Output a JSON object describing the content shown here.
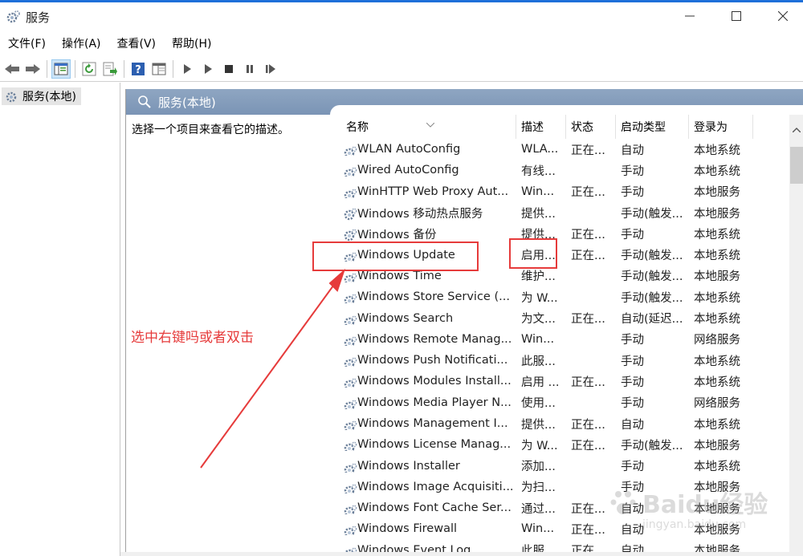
{
  "window": {
    "title": "服务",
    "accent": "#1e6fd9"
  },
  "menu": [
    "文件(F)",
    "操作(A)",
    "查看(V)",
    "帮助(H)"
  ],
  "toolbar_icons": [
    "back-icon",
    "forward-icon",
    "show-hide-tree-icon",
    "refresh-icon",
    "export-list-icon",
    "help-icon",
    "properties-icon",
    "start-service-icon",
    "start-icon",
    "stop-service-icon",
    "pause-service-icon",
    "restart-service-icon"
  ],
  "tree": {
    "root": "服务(本地)"
  },
  "pane": {
    "header": "服务(本地)",
    "description": "选择一个项目来查看它的描述。"
  },
  "columns": {
    "name": "名称",
    "desc": "描述",
    "status": "状态",
    "type": "启动类型",
    "logon": "登录为"
  },
  "services": [
    {
      "name": "WLAN AutoConfig",
      "desc": "WLA...",
      "status": "正在...",
      "type": "自动",
      "logon": "本地系统"
    },
    {
      "name": "Wired AutoConfig",
      "desc": "有线...",
      "status": "",
      "type": "手动",
      "logon": "本地系统"
    },
    {
      "name": "WinHTTP Web Proxy Aut...",
      "desc": "Win...",
      "status": "正在...",
      "type": "手动",
      "logon": "本地服务"
    },
    {
      "name": "Windows 移动热点服务",
      "desc": "提供...",
      "status": "",
      "type": "手动(触发...",
      "logon": "本地服务"
    },
    {
      "name": "Windows 备份",
      "desc": "提供...",
      "status": "正在...",
      "type": "手动",
      "logon": "本地系统"
    },
    {
      "name": "Windows Update",
      "desc": "启用...",
      "status": "正在...",
      "type": "手动(触发...",
      "logon": "本地系统"
    },
    {
      "name": "Windows Time",
      "desc": "维护...",
      "status": "",
      "type": "手动(触发...",
      "logon": "本地服务"
    },
    {
      "name": "Windows Store Service (...",
      "desc": "为 W...",
      "status": "",
      "type": "手动(触发...",
      "logon": "本地系统"
    },
    {
      "name": "Windows Search",
      "desc": "为文...",
      "status": "正在...",
      "type": "自动(延迟...",
      "logon": "本地系统"
    },
    {
      "name": "Windows Remote Manag...",
      "desc": "Win...",
      "status": "",
      "type": "手动",
      "logon": "网络服务"
    },
    {
      "name": "Windows Push Notificati...",
      "desc": "此服...",
      "status": "",
      "type": "手动",
      "logon": "本地系统"
    },
    {
      "name": "Windows Modules Install...",
      "desc": "启用 ...",
      "status": "正在...",
      "type": "手动",
      "logon": "本地系统"
    },
    {
      "name": "Windows Media Player N...",
      "desc": "使用...",
      "status": "",
      "type": "手动",
      "logon": "网络服务"
    },
    {
      "name": "Windows Management I...",
      "desc": "提供...",
      "status": "正在...",
      "type": "自动",
      "logon": "本地系统"
    },
    {
      "name": "Windows License Manag...",
      "desc": "为 W...",
      "status": "正在...",
      "type": "手动(触发...",
      "logon": "本地服务"
    },
    {
      "name": "Windows Installer",
      "desc": "添加...",
      "status": "",
      "type": "手动",
      "logon": "本地系统"
    },
    {
      "name": "Windows Image Acquisiti...",
      "desc": "为扫...",
      "status": "",
      "type": "手动",
      "logon": "本地服务"
    },
    {
      "name": "Windows Font Cache Ser...",
      "desc": "通过...",
      "status": "正在...",
      "type": "自动",
      "logon": "本地服务"
    },
    {
      "name": "Windows Firewall",
      "desc": "Win...",
      "status": "正在...",
      "type": "自动",
      "logon": "本地服务"
    },
    {
      "name": "Windows Event Log",
      "desc": "此服...",
      "status": "正在...",
      "type": "自动",
      "logon": "本地服务"
    }
  ],
  "annotation": {
    "text": "选中右键吗或者双击",
    "color": "#e63b3b"
  },
  "watermark": {
    "text": "Baidu经验",
    "sub": "jingyan.baidu.com"
  }
}
